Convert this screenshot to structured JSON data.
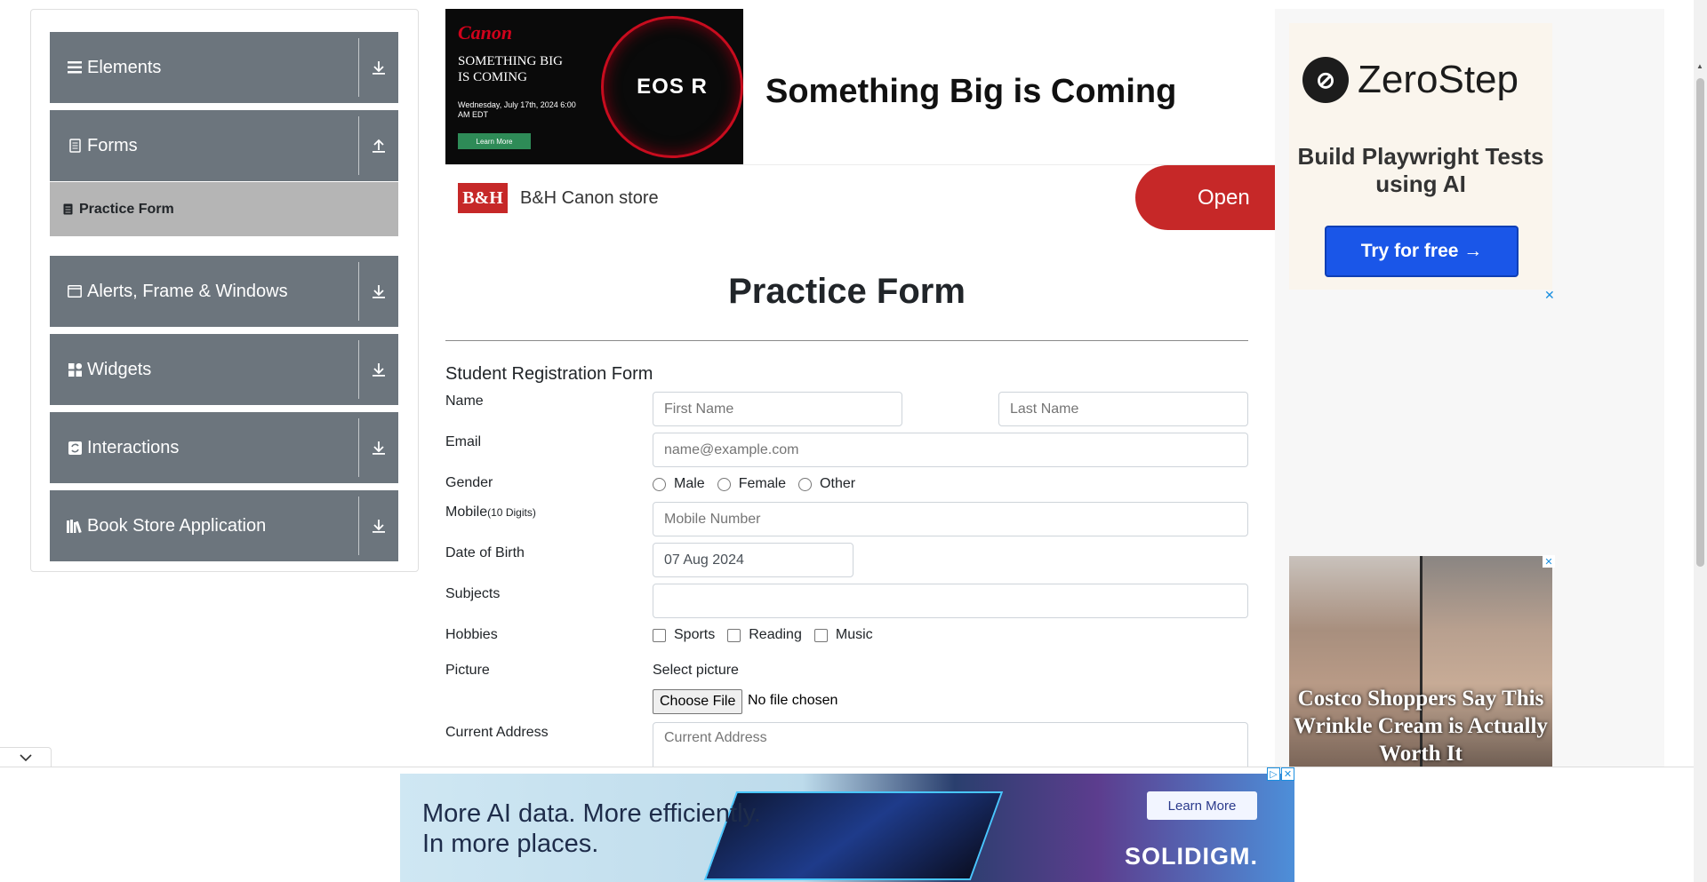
{
  "sidebar": {
    "groups": [
      {
        "label": "Elements",
        "icon": "menu-icon",
        "arrow": "download-arrow-icon"
      },
      {
        "label": "Forms",
        "icon": "document-icon",
        "arrow": "upload-arrow-icon"
      },
      {
        "label": "Alerts, Frame & Windows",
        "icon": "window-icon",
        "arrow": "download-arrow-icon"
      },
      {
        "label": "Widgets",
        "icon": "widgets-icon",
        "arrow": "download-arrow-icon"
      },
      {
        "label": "Interactions",
        "icon": "interactions-icon",
        "arrow": "download-arrow-icon"
      },
      {
        "label": "Book Store Application",
        "icon": "books-icon",
        "arrow": "download-arrow-icon"
      }
    ],
    "active_item": {
      "label": "Practice Form",
      "icon": "form-icon"
    }
  },
  "top_ad": {
    "brand": "Canon",
    "tagline": "SOMETHING BIG IS COMING",
    "date": "Wednesday, July 17th, 2024 6:00 AM EDT",
    "cta": "Learn More",
    "product": "EOS R",
    "headline": "Something Big is Coming",
    "store_logo": "B&H",
    "store_name": "B&H Canon store",
    "open_label": "Open"
  },
  "right_ad": {
    "brand": "ZeroStep",
    "tagline": "Build Playwright Tests using AI",
    "cta": "Try for free →",
    "close": "✕"
  },
  "costco_ad": {
    "headline": "Costco Shoppers Say This Wrinkle Cream is Actually Worth It",
    "close": "✕"
  },
  "form": {
    "title": "Practice Form",
    "subtitle": "Student Registration Form",
    "labels": {
      "name": "Name",
      "email": "Email",
      "gender": "Gender",
      "mobile": "Mobile",
      "mobile_hint": "(10 Digits)",
      "dob": "Date of Birth",
      "subjects": "Subjects",
      "hobbies": "Hobbies",
      "picture": "Picture",
      "address": "Current Address"
    },
    "placeholders": {
      "first_name": "First Name",
      "last_name": "Last Name",
      "email": "name@example.com",
      "mobile": "Mobile Number",
      "address": "Current Address"
    },
    "dob_value": "07 Aug 2024",
    "gender_options": [
      "Male",
      "Female",
      "Other"
    ],
    "hobby_options": [
      "Sports",
      "Reading",
      "Music"
    ],
    "picture_hint": "Select picture",
    "choose_file": "Choose File",
    "no_file": "No file chosen"
  },
  "bottom_ad": {
    "line1": "More AI data. More efficiently.",
    "line2": "In more places.",
    "cta": "Learn More",
    "brand": "SOLIDIGM."
  },
  "colors": {
    "sidebar_group": "#6c757d",
    "sidebar_active": "#b5b5b5",
    "canon_red": "#d0021b",
    "open_red": "#c62828",
    "zerostep_blue": "#1a56e8"
  }
}
